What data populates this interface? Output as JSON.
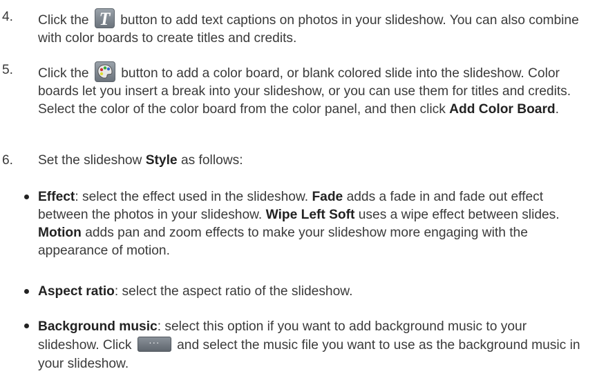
{
  "steps": [
    {
      "num": "4.",
      "pre": "Click the",
      "post": "button to add text captions on photos in your slideshow. You can also combine with color boards to create titles and credits.",
      "icon": "text-caption-icon"
    },
    {
      "num": "5.",
      "pre": "Click the",
      "post1": "button to add a color board, or blank colored slide into the slideshow. Color boards let you insert a break into your slideshow, or you can use them for titles and credits. Select the color of the color board from the color panel, and then click",
      "bold": "Add Color Board",
      "end": ".",
      "icon": "palette-icon"
    },
    {
      "num": "6.",
      "pre": "Set the slideshow",
      "bold": "Style",
      "post": "as follows:"
    }
  ],
  "bullets": [
    {
      "term": "Effect",
      "text1": ": select the effect used in the slideshow.",
      "b1": "Fade",
      "text2": "adds a fade in and fade out effect between the photos in your slideshow.",
      "b2": "Wipe Left Soft",
      "text3": "uses a wipe effect between slides.",
      "b3": "Motion",
      "text4": "adds pan and zoom effects to make your slideshow more engaging with the appearance of motion."
    },
    {
      "term": "Aspect ratio",
      "text": ": select the aspect ratio of the slideshow."
    },
    {
      "term": "Background music",
      "text1": ": select this option if you want to add background music to your slideshow. Click",
      "text2": "and select the music file you want to use as the background music in your slideshow.",
      "icon": "more-options-icon"
    }
  ],
  "icons": {
    "t_glyph": "T",
    "more_glyph": "···"
  },
  "colors": {
    "text": "#3a3a3a",
    "bold": "#222222",
    "icon_bg": "#7d858d"
  }
}
